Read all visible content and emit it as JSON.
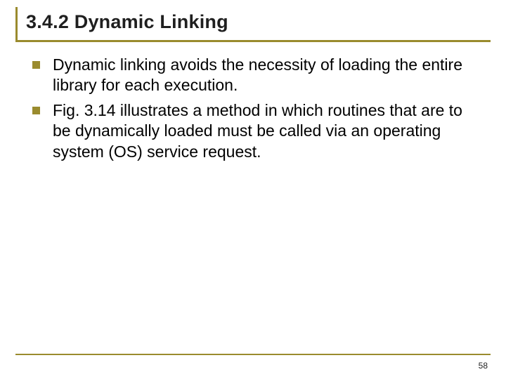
{
  "title": "3.4.2 Dynamic Linking",
  "bullets": {
    "b0": "Dynamic linking avoids the necessity of loading the entire library for each execution.",
    "b1": "Fig. 3.14 illustrates a method in which routines that are to be dynamically loaded must be called via an operating system (OS) service request."
  },
  "pageNumber": "58"
}
